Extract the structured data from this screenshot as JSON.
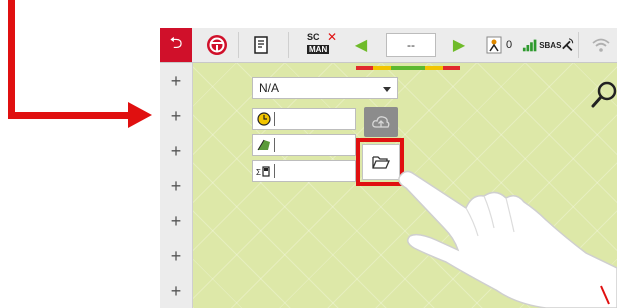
{
  "toolbar": {
    "back_icon": "return-arrow-icon",
    "steering_icon": "steering-wheel-icon",
    "sim_icon": "document-settings-icon",
    "mode_badge_top": "SC",
    "mode_badge_bottom": "MAN",
    "prev_icon": "triangle-left-icon",
    "guidance_value": "--",
    "next_icon": "triangle-right-icon",
    "satellite_count": "0",
    "signal_label": "SBAS",
    "wifi_icon": "wifi-icon"
  },
  "lightbar_colors": [
    "#e12b2b",
    "#f2c500",
    "#5cb82e",
    "#5cb82e",
    "#f2c500",
    "#e12b2b"
  ],
  "leftbar": {
    "items": [
      "+",
      "+",
      "+",
      "+",
      "+",
      "+",
      "+"
    ]
  },
  "form": {
    "dropdown_value": "N/A",
    "fields": [
      {
        "icon": "clock-icon",
        "value": ""
      },
      {
        "icon": "area-icon",
        "value": ""
      },
      {
        "icon": "fuel-sum-icon",
        "value": ""
      }
    ],
    "upload_icon": "cloud-upload-icon",
    "folder_icon": "folder-open-icon"
  },
  "colors": {
    "accent_red": "#d0102a",
    "map_background": "#dde8a8",
    "annotation_red": "#e01010"
  }
}
